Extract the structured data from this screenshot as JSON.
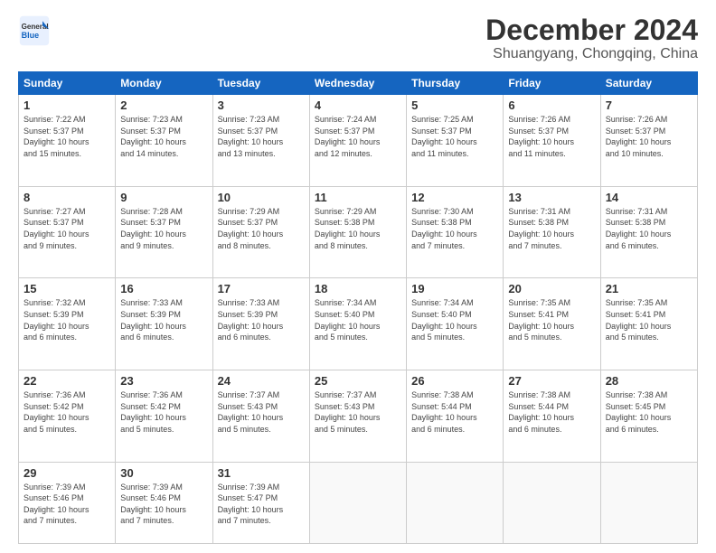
{
  "header": {
    "logo_line1": "General",
    "logo_line2": "Blue",
    "title": "December 2024",
    "subtitle": "Shuangyang, Chongqing, China"
  },
  "weekdays": [
    "Sunday",
    "Monday",
    "Tuesday",
    "Wednesday",
    "Thursday",
    "Friday",
    "Saturday"
  ],
  "weeks": [
    [
      {
        "day": "1",
        "info": "Sunrise: 7:22 AM\nSunset: 5:37 PM\nDaylight: 10 hours\nand 15 minutes."
      },
      {
        "day": "2",
        "info": "Sunrise: 7:23 AM\nSunset: 5:37 PM\nDaylight: 10 hours\nand 14 minutes."
      },
      {
        "day": "3",
        "info": "Sunrise: 7:23 AM\nSunset: 5:37 PM\nDaylight: 10 hours\nand 13 minutes."
      },
      {
        "day": "4",
        "info": "Sunrise: 7:24 AM\nSunset: 5:37 PM\nDaylight: 10 hours\nand 12 minutes."
      },
      {
        "day": "5",
        "info": "Sunrise: 7:25 AM\nSunset: 5:37 PM\nDaylight: 10 hours\nand 11 minutes."
      },
      {
        "day": "6",
        "info": "Sunrise: 7:26 AM\nSunset: 5:37 PM\nDaylight: 10 hours\nand 11 minutes."
      },
      {
        "day": "7",
        "info": "Sunrise: 7:26 AM\nSunset: 5:37 PM\nDaylight: 10 hours\nand 10 minutes."
      }
    ],
    [
      {
        "day": "8",
        "info": "Sunrise: 7:27 AM\nSunset: 5:37 PM\nDaylight: 10 hours\nand 9 minutes."
      },
      {
        "day": "9",
        "info": "Sunrise: 7:28 AM\nSunset: 5:37 PM\nDaylight: 10 hours\nand 9 minutes."
      },
      {
        "day": "10",
        "info": "Sunrise: 7:29 AM\nSunset: 5:37 PM\nDaylight: 10 hours\nand 8 minutes."
      },
      {
        "day": "11",
        "info": "Sunrise: 7:29 AM\nSunset: 5:38 PM\nDaylight: 10 hours\nand 8 minutes."
      },
      {
        "day": "12",
        "info": "Sunrise: 7:30 AM\nSunset: 5:38 PM\nDaylight: 10 hours\nand 7 minutes."
      },
      {
        "day": "13",
        "info": "Sunrise: 7:31 AM\nSunset: 5:38 PM\nDaylight: 10 hours\nand 7 minutes."
      },
      {
        "day": "14",
        "info": "Sunrise: 7:31 AM\nSunset: 5:38 PM\nDaylight: 10 hours\nand 6 minutes."
      }
    ],
    [
      {
        "day": "15",
        "info": "Sunrise: 7:32 AM\nSunset: 5:39 PM\nDaylight: 10 hours\nand 6 minutes."
      },
      {
        "day": "16",
        "info": "Sunrise: 7:33 AM\nSunset: 5:39 PM\nDaylight: 10 hours\nand 6 minutes."
      },
      {
        "day": "17",
        "info": "Sunrise: 7:33 AM\nSunset: 5:39 PM\nDaylight: 10 hours\nand 6 minutes."
      },
      {
        "day": "18",
        "info": "Sunrise: 7:34 AM\nSunset: 5:40 PM\nDaylight: 10 hours\nand 5 minutes."
      },
      {
        "day": "19",
        "info": "Sunrise: 7:34 AM\nSunset: 5:40 PM\nDaylight: 10 hours\nand 5 minutes."
      },
      {
        "day": "20",
        "info": "Sunrise: 7:35 AM\nSunset: 5:41 PM\nDaylight: 10 hours\nand 5 minutes."
      },
      {
        "day": "21",
        "info": "Sunrise: 7:35 AM\nSunset: 5:41 PM\nDaylight: 10 hours\nand 5 minutes."
      }
    ],
    [
      {
        "day": "22",
        "info": "Sunrise: 7:36 AM\nSunset: 5:42 PM\nDaylight: 10 hours\nand 5 minutes."
      },
      {
        "day": "23",
        "info": "Sunrise: 7:36 AM\nSunset: 5:42 PM\nDaylight: 10 hours\nand 5 minutes."
      },
      {
        "day": "24",
        "info": "Sunrise: 7:37 AM\nSunset: 5:43 PM\nDaylight: 10 hours\nand 5 minutes."
      },
      {
        "day": "25",
        "info": "Sunrise: 7:37 AM\nSunset: 5:43 PM\nDaylight: 10 hours\nand 5 minutes."
      },
      {
        "day": "26",
        "info": "Sunrise: 7:38 AM\nSunset: 5:44 PM\nDaylight: 10 hours\nand 6 minutes."
      },
      {
        "day": "27",
        "info": "Sunrise: 7:38 AM\nSunset: 5:44 PM\nDaylight: 10 hours\nand 6 minutes."
      },
      {
        "day": "28",
        "info": "Sunrise: 7:38 AM\nSunset: 5:45 PM\nDaylight: 10 hours\nand 6 minutes."
      }
    ],
    [
      {
        "day": "29",
        "info": "Sunrise: 7:39 AM\nSunset: 5:46 PM\nDaylight: 10 hours\nand 7 minutes."
      },
      {
        "day": "30",
        "info": "Sunrise: 7:39 AM\nSunset: 5:46 PM\nDaylight: 10 hours\nand 7 minutes."
      },
      {
        "day": "31",
        "info": "Sunrise: 7:39 AM\nSunset: 5:47 PM\nDaylight: 10 hours\nand 7 minutes."
      },
      {
        "day": "",
        "info": ""
      },
      {
        "day": "",
        "info": ""
      },
      {
        "day": "",
        "info": ""
      },
      {
        "day": "",
        "info": ""
      }
    ]
  ]
}
